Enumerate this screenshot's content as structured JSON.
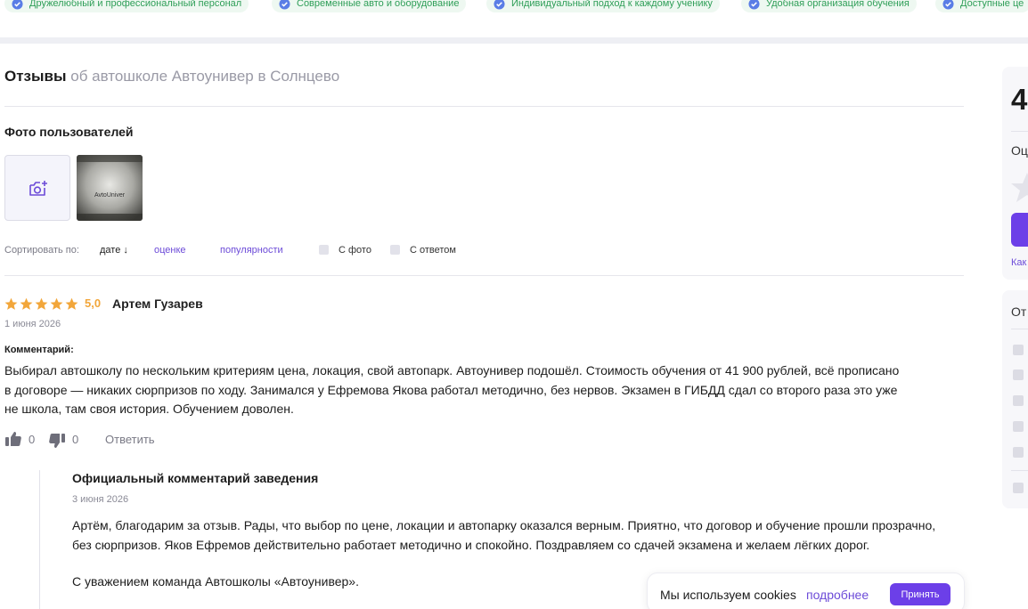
{
  "features": [
    "Дружелюбный и профессиональный персонал",
    "Современные авто и оборудование",
    "Индивидуальный подход к каждому ученику",
    "Удобная организация обучения",
    "Доступные це"
  ],
  "heading": {
    "strong": "Отзывы",
    "muted": "об автошколе Автоунивер в Солнцево"
  },
  "photos": {
    "title": "Фото пользователей",
    "thumb_text": "AvtoUniver"
  },
  "sort": {
    "label": "Сортировать по:",
    "date": "дате ↓",
    "rating": "оценке",
    "popularity": "популярности",
    "with_photo": "С фото",
    "with_answer": "С ответом"
  },
  "review": {
    "rating": 5,
    "score": "5,0",
    "author": "Артем Гузарев",
    "date": "1 июня 2026",
    "comment_label": "Комментарий:",
    "lines": [
      "Выбирал автошколу по нескольким критериям цена, локация, свой автопарк. Автоунивер подошёл. Стоимость обучения от 41 900 рублей, всё прописано",
      "в договоре — никаких сюрпризов по ходу. Занимался у Ефремова Якова работал методично, без нервов. Экзамен в ГИБДД сдал со второго раза это уже",
      "не школа, там своя история. Обучением доволен."
    ],
    "likes": "0",
    "dislikes": "0",
    "reply": "Ответить"
  },
  "answer": {
    "title": "Официальный комментарий заведения",
    "date": "3 июня 2026",
    "lines": [
      "Артём, благодарим за отзыв. Рады, что выбор по цене, локации и автопарку оказался верным. Приятно, что договор и обучение прошли прозрачно,",
      "без сюрпризов. Яков Ефремов действительно работает методично и спокойно. Поздравляем со сдачей экзамена и желаем лёгких дорог."
    ],
    "sign": "С уважением команда Автошколы «Автоунивер»."
  },
  "cookie": {
    "text": "Мы используем cookies",
    "more": "подробнее",
    "accept": "Принять"
  },
  "sidebar": {
    "score": "4",
    "rate_label": "Оц",
    "link": "Как",
    "filter_title": "От"
  },
  "colors": {
    "accent": "#6c3fe8",
    "star": "#f2a63a",
    "chip_text": "#2e9e57",
    "chip_bg": "#eef8f1"
  }
}
